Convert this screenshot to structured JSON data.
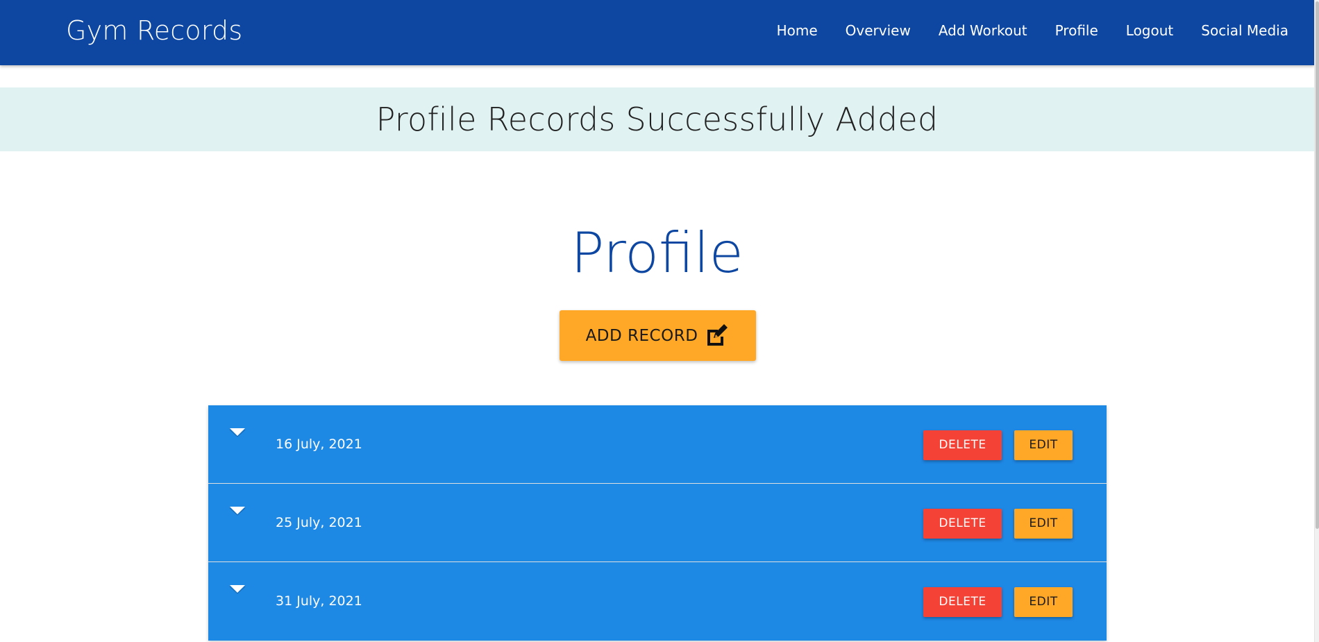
{
  "nav": {
    "brand": "Gym Records",
    "links": [
      "Home",
      "Overview",
      "Add Workout",
      "Profile",
      "Logout",
      "Social Media"
    ]
  },
  "flash": {
    "message": "Profile Records Successfully Added"
  },
  "page": {
    "title": "Profile"
  },
  "add_button": {
    "label": "ADD RECORD",
    "icon": "edit-square-icon"
  },
  "records": [
    {
      "date": "16 July, 2021",
      "delete_label": "DELETE",
      "edit_label": "EDIT"
    },
    {
      "date": "25 July, 2021",
      "delete_label": "DELETE",
      "edit_label": "EDIT"
    },
    {
      "date": "31 July, 2021",
      "delete_label": "DELETE",
      "edit_label": "EDIT"
    }
  ],
  "colors": {
    "nav_bg": "#0d47a1",
    "flash_bg": "#e0f2f1",
    "title": "#0d47a1",
    "accent_orange": "#ffa726",
    "row_bg": "#1e88e5",
    "delete_red": "#f44336"
  }
}
